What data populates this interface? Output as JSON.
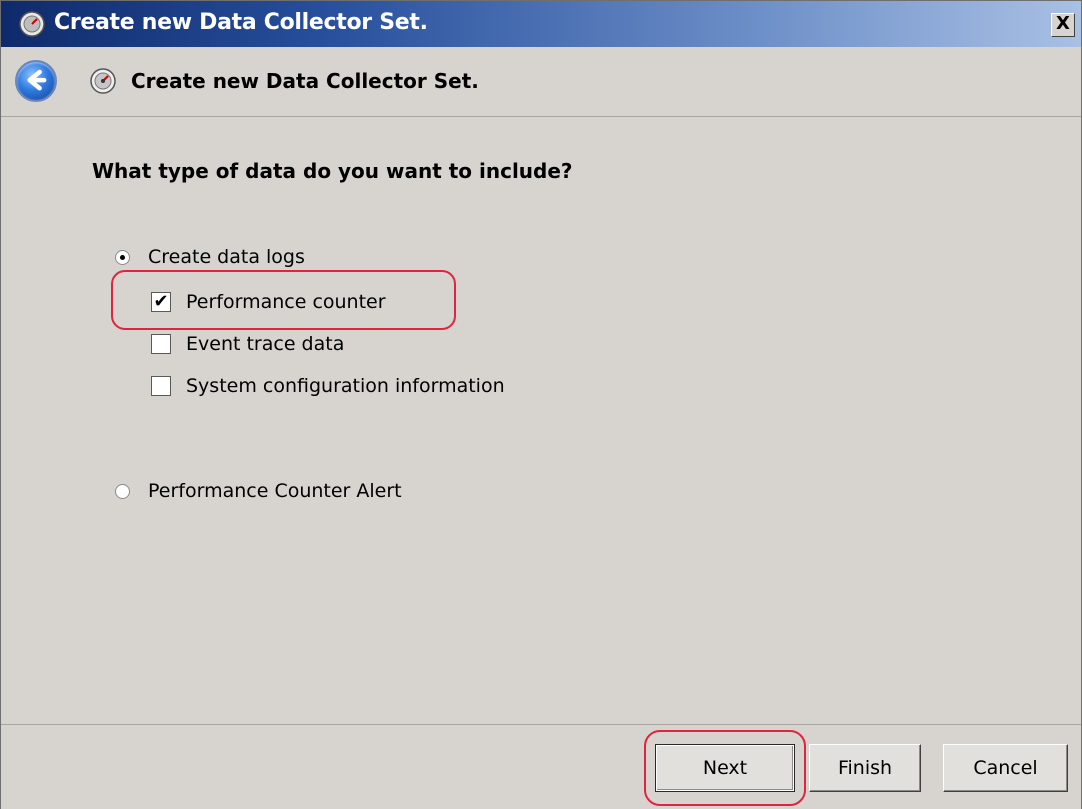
{
  "window": {
    "title": "Create new Data Collector Set.",
    "close_label": "X"
  },
  "header": {
    "title": "Create new Data Collector Set."
  },
  "main": {
    "question": "What type of data do you want to include?",
    "options": {
      "create_logs": {
        "label": "Create data logs",
        "selected": true
      },
      "performance_counter": {
        "label": "Performance counter",
        "checked": true
      },
      "event_trace": {
        "label": "Event trace data",
        "checked": false
      },
      "system_config": {
        "label": "System configuration information",
        "checked": false
      },
      "alert": {
        "label": "Performance Counter Alert",
        "selected": false
      }
    }
  },
  "footer": {
    "next_label": "Next",
    "finish_label": "Finish",
    "cancel_label": "Cancel"
  },
  "colors": {
    "title_bar_start": "#0f2a6b",
    "title_bar_end": "#a9c0e4",
    "dialog_background": "#d7d4cf",
    "highlight": "#e0243f"
  }
}
